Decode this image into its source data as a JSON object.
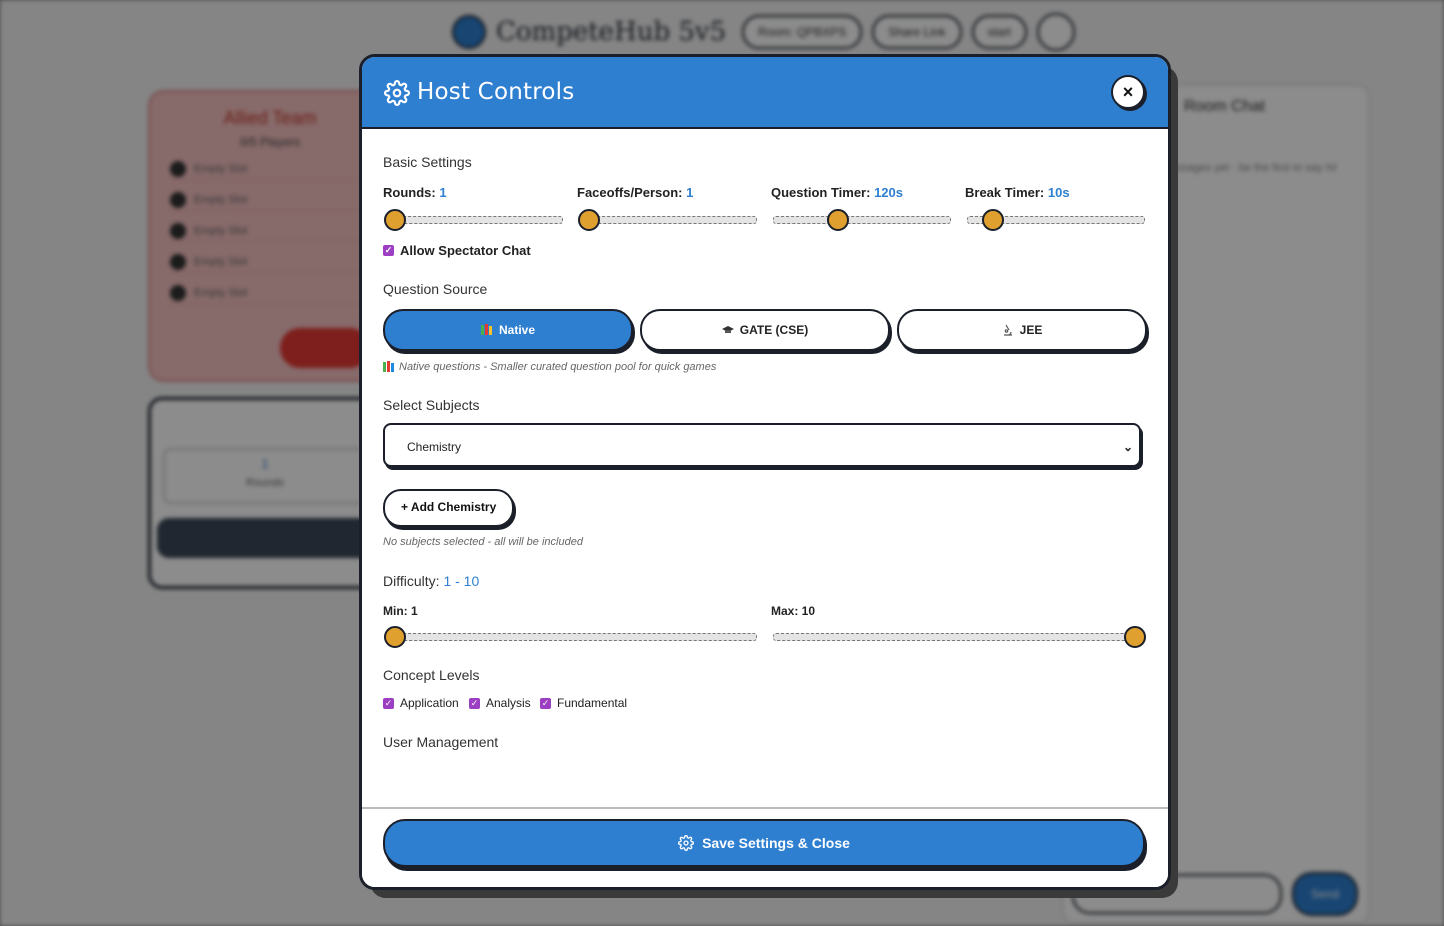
{
  "background": {
    "brand": "CompeteHub 5v5",
    "header_pills": [
      "Room: QPBXPS",
      "Share Link",
      "start"
    ],
    "team_title": "Allied Team",
    "team_sub": "0/5 Players",
    "slot_label": "Empty Slot",
    "stat_value": "1",
    "stat_label": "Rounds",
    "chat_title": "Room Chat",
    "chat_hint": "No messages yet - be the first to say hi!",
    "send_label": "Send"
  },
  "modal": {
    "title": "Host Controls",
    "close_label": "×"
  },
  "basic": {
    "heading": "Basic Settings",
    "rounds_label": "Rounds:",
    "rounds_value": "1",
    "rounds_level": 0.0,
    "faceoffs_label": "Faceoffs/Person:",
    "faceoffs_value": "1",
    "faceoffs_level": 0.0,
    "qtimer_label": "Question Timer:",
    "qtimer_value": "120s",
    "qtimer_level": 0.35,
    "btimer_label": "Break Timer:",
    "btimer_value": "10s",
    "btimer_level": 0.1,
    "spectator_label": "Allow Spectator Chat"
  },
  "source": {
    "heading": "Question Source",
    "options": [
      {
        "label": "Native",
        "icon": "books-icon"
      },
      {
        "label": "GATE (CSE)",
        "icon": "graduation-cap-icon"
      },
      {
        "label": "JEE",
        "icon": "microscope-icon"
      }
    ],
    "selected": "Native",
    "note": "Native questions - Smaller curated question pool for quick games"
  },
  "subjects": {
    "heading": "Select Subjects",
    "selected_value": "Chemistry",
    "add_label": "+ Add Chemistry",
    "note": "No subjects selected - all will be included"
  },
  "difficulty": {
    "heading": "Difficulty:",
    "range": "1 - 10",
    "min_label": "Min: 1",
    "max_label": "Max: 10",
    "min_level": 0.0,
    "max_level": 1.0
  },
  "concepts": {
    "heading": "Concept Levels",
    "items": [
      "Application",
      "Analysis",
      "Fundamental"
    ]
  },
  "users": {
    "heading": "User Management"
  },
  "footer": {
    "save_label": "Save Settings & Close"
  },
  "colors": {
    "primary": "#2f7fd1",
    "thumb": "#e0a030",
    "checkbox": "#9c3fc2"
  }
}
